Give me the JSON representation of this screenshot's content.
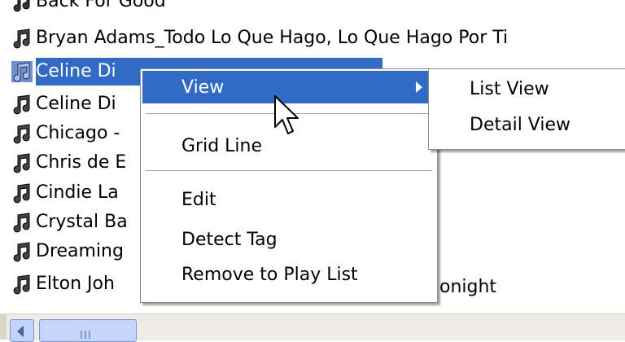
{
  "file_list": {
    "rows": [
      {
        "label": "Back For Good",
        "selected": false
      },
      {
        "label": "Bryan Adams_Todo Lo Que Hago, Lo Que Hago Por Ti",
        "selected": false
      },
      {
        "label": "Celine Di",
        "selected": true,
        "hidden_suffix": "Celine Di… (partially hidden) …",
        "visible_after_menu": ""
      },
      {
        "label": "Celine Di",
        "selected": false
      },
      {
        "label": "Chicago -",
        "selected": false
      },
      {
        "label": "Chris de E",
        "selected": false
      },
      {
        "label": "Cindie La",
        "selected": false
      },
      {
        "label": "Crystal Ba",
        "selected": false
      },
      {
        "label": "Dreaming",
        "selected": false
      },
      {
        "label": "Elton Joh",
        "selected": false,
        "visible_after_menu": "onight"
      }
    ]
  },
  "context_menu": {
    "items": [
      {
        "label": "View",
        "has_submenu": true,
        "highlighted": true
      },
      {
        "label": "Grid Line"
      },
      {
        "label": "Edit"
      },
      {
        "label": "Detect Tag"
      },
      {
        "label": "Remove to Play List"
      }
    ]
  },
  "submenu": {
    "items": [
      {
        "label": "List View"
      },
      {
        "label": "Detail View"
      }
    ]
  },
  "colors": {
    "selection": "#316ac5",
    "menu_bg": "#ffffff",
    "scrollbar_bg": "#eeede5"
  },
  "icons": {
    "song": "music-note-icon",
    "cursor": "arrow-cursor-icon",
    "scroll_left": "scroll-left-arrow-icon"
  }
}
